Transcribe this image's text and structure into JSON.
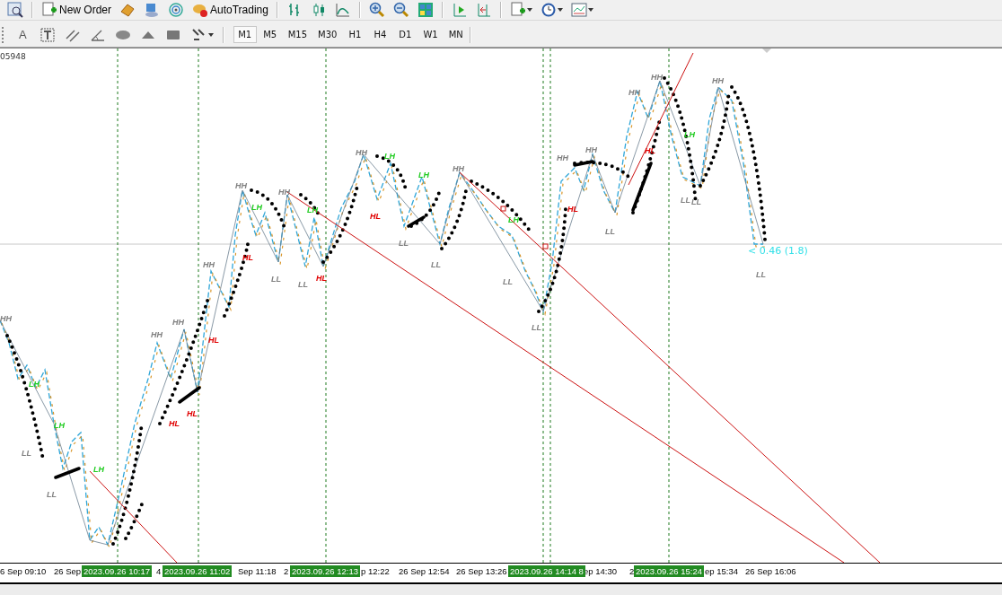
{
  "toolbar": {
    "new_order": "New Order",
    "autotrading": "AutoTrading"
  },
  "drawing_tools": {
    "text_tool": "A"
  },
  "timeframes": [
    {
      "label": "M1",
      "selected": true
    },
    {
      "label": "M5",
      "selected": false
    },
    {
      "label": "M15",
      "selected": false
    },
    {
      "label": "M30",
      "selected": false
    },
    {
      "label": "H1",
      "selected": false
    },
    {
      "label": "H4",
      "selected": false
    },
    {
      "label": "D1",
      "selected": false
    },
    {
      "label": "W1",
      "selected": false
    },
    {
      "label": "MN",
      "selected": false
    }
  ],
  "chart": {
    "symbol_info": "05948",
    "price_label": "< 0.46 (1.8)",
    "swing_labels": [
      {
        "text": "HH",
        "color": "#808080"
      },
      {
        "text": "LH",
        "color": "#22cc22"
      },
      {
        "text": "LH",
        "color": "#22cc22"
      },
      {
        "text": "LL",
        "color": "#808080"
      },
      {
        "text": "LL",
        "color": "#808080"
      },
      {
        "text": "LH",
        "color": "#22cc22"
      },
      {
        "text": "HH",
        "color": "#808080"
      },
      {
        "text": "HH",
        "color": "#808080"
      },
      {
        "text": "HH",
        "color": "#808080"
      },
      {
        "text": "HL",
        "color": "#e00000"
      },
      {
        "text": "HL",
        "color": "#e00000"
      },
      {
        "text": "HL",
        "color": "#e00000"
      },
      {
        "text": "HH",
        "color": "#808080"
      },
      {
        "text": "LH",
        "color": "#22cc22"
      },
      {
        "text": "HL",
        "color": "#e00000"
      },
      {
        "text": "LL",
        "color": "#808080"
      },
      {
        "text": "HH",
        "color": "#808080"
      },
      {
        "text": "LH",
        "color": "#22cc22"
      },
      {
        "text": "LL",
        "color": "#808080"
      },
      {
        "text": "HL",
        "color": "#e00000"
      },
      {
        "text": "HH",
        "color": "#808080"
      },
      {
        "text": "LH",
        "color": "#22cc22"
      },
      {
        "text": "HL",
        "color": "#e00000"
      },
      {
        "text": "LL",
        "color": "#808080"
      },
      {
        "text": "LH",
        "color": "#22cc22"
      },
      {
        "text": "HH",
        "color": "#808080"
      },
      {
        "text": "LL",
        "color": "#808080"
      },
      {
        "text": "LH",
        "color": "#22cc22"
      },
      {
        "text": "LL",
        "color": "#808080"
      },
      {
        "text": "LL",
        "color": "#808080"
      },
      {
        "text": "HH",
        "color": "#808080"
      },
      {
        "text": "HH",
        "color": "#808080"
      },
      {
        "text": "HL",
        "color": "#e00000"
      },
      {
        "text": "LL",
        "color": "#808080"
      },
      {
        "text": "HH",
        "color": "#808080"
      },
      {
        "text": "HH",
        "color": "#808080"
      },
      {
        "text": "HL",
        "color": "#e00000"
      },
      {
        "text": "LH",
        "color": "#22cc22"
      },
      {
        "text": "LL",
        "color": "#808080"
      },
      {
        "text": "LL",
        "color": "#808080"
      },
      {
        "text": "HH",
        "color": "#808080"
      },
      {
        "text": "LL",
        "color": "#808080"
      }
    ],
    "time_axis": [
      "6 Sep 09:10",
      "26 Sep",
      "4",
      "Sep 11:18",
      "2",
      "p 12:22",
      "26 Sep 12:54",
      "26 Sep 13:26",
      "ep 14:30",
      "2",
      "ep 15:34",
      "26 Sep 16:06"
    ],
    "time_markers": [
      "2023.09.26 10:17",
      "2023.09.26 11:02",
      "2023.09.26 12:13",
      "2023.09.26 14:14 8",
      "2023.09.26 15:24"
    ]
  }
}
